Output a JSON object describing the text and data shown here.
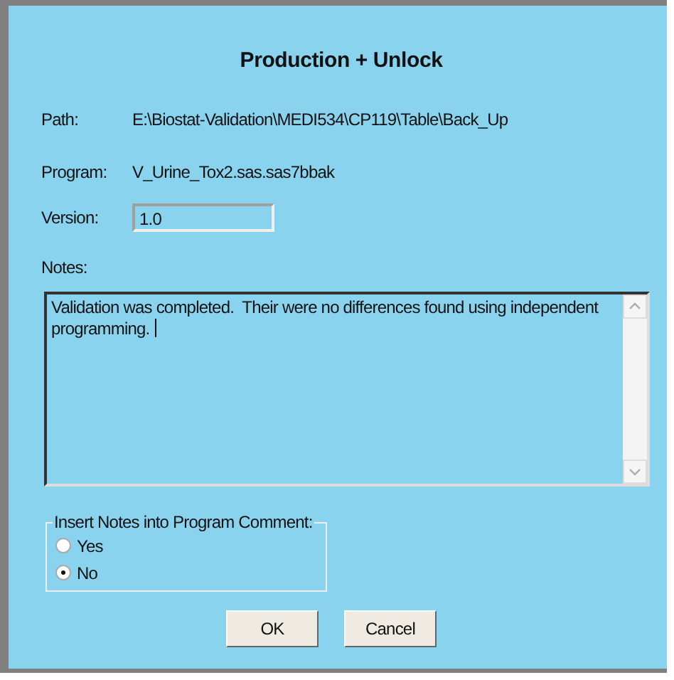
{
  "dialog": {
    "title": "Production + Unlock"
  },
  "fields": [
    {
      "kind": "text",
      "label": "Path:",
      "value": "E:\\Biostat-Validation\\MEDI534\\CP119\\Table\\Back_Up"
    },
    {
      "kind": "text",
      "label": "Program:",
      "value": "V_Urine_Tox2.sas.sas7bbak"
    },
    {
      "kind": "input",
      "label": "Version:",
      "value": "1.0"
    }
  ],
  "notes": {
    "label": "Notes:",
    "value": "Validation was completed.  Their were no differences found using independent programming. "
  },
  "insert_notes": {
    "legend": "Insert Notes into Program Comment:",
    "options": [
      {
        "label": "Yes",
        "selected": false
      },
      {
        "label": "No",
        "selected": true
      }
    ]
  },
  "buttons": [
    "OK",
    "Cancel"
  ]
}
